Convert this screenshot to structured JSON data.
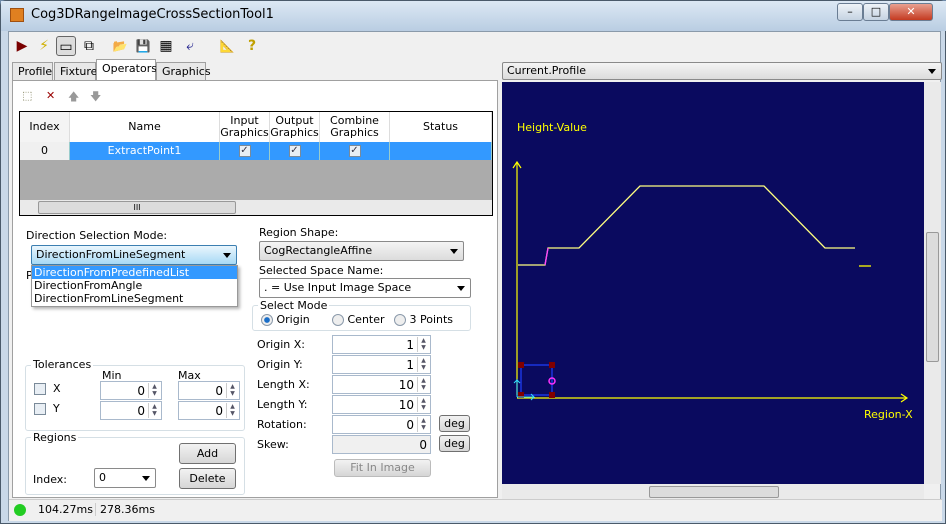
{
  "window": {
    "title": "Cog3DRangeImageCrossSectionTool1",
    "minimize": "–",
    "maximize": "□",
    "close": "✕"
  },
  "toolbar": {
    "icons": [
      "run-icon",
      "electric-icon",
      "show-controls-icon",
      "floating-icon",
      "open-icon",
      "save-icon",
      "save-settings-icon",
      "reset-icon",
      "measure-icon",
      "help-icon"
    ],
    "glyphs": [
      "▶",
      "⚡",
      "▭",
      "⧉",
      "📂",
      "💾",
      "▦",
      "⤶",
      "📐",
      "?"
    ]
  },
  "tabs": [
    {
      "label": "Profile"
    },
    {
      "label": "Fixture"
    },
    {
      "label": "Operators",
      "selected": true
    },
    {
      "label": "Graphics"
    }
  ],
  "ops_toolbar": {
    "new": "⬚",
    "delete": "✕",
    "up": "🡅",
    "down": "🡇"
  },
  "grid": {
    "columns": [
      "Index",
      "Name",
      "Input Graphics",
      "Output Graphics",
      "Combine Graphics",
      "Status"
    ],
    "rows": [
      {
        "index": "0",
        "name": "ExtractPoint1",
        "input": "✓",
        "output": "✓",
        "combine": "✓",
        "status": ""
      }
    ],
    "scroll_thumb": "III"
  },
  "direction": {
    "label": "Direction Selection Mode:",
    "value": "DirectionFromLineSegment",
    "options": [
      "DirectionFromPredefinedList",
      "DirectionFromAngle",
      "DirectionFromLineSegment"
    ],
    "highlighted": 0,
    "hidden_label_initial": "P"
  },
  "tolerances": {
    "legend": "Tolerances",
    "min": "Min",
    "max": "Max",
    "x_label": "X",
    "y_label": "Y",
    "x_min": "0",
    "x_max": "0",
    "y_min": "0",
    "y_max": "0"
  },
  "regions": {
    "legend": "Regions",
    "add": "Add",
    "delete": "Delete",
    "index_label": "Index:",
    "index_value": "0"
  },
  "region_shape": {
    "label": "Region Shape:",
    "value": "CogRectangleAffine"
  },
  "space": {
    "label": "Selected Space Name:",
    "value": ". = Use Input Image Space"
  },
  "select_mode": {
    "legend": "Select Mode",
    "options": [
      "Origin",
      "Center",
      "3 Points"
    ],
    "selected": 0
  },
  "params": [
    {
      "label": "Origin X:",
      "value": "1"
    },
    {
      "label": "Origin Y:",
      "value": "1"
    },
    {
      "label": "Length X:",
      "value": "10"
    },
    {
      "label": "Length Y:",
      "value": "10"
    },
    {
      "label": "Rotation:",
      "value": "0",
      "unit": "deg"
    },
    {
      "label": "Skew:",
      "value": "0",
      "unit": "deg"
    }
  ],
  "fit_button": "Fit In Image",
  "display": {
    "selector": "Current.Profile",
    "y_axis_label": "Height-Value",
    "x_axis_label": "Region-X",
    "background": "#0a0a5f",
    "axis_color": "#ffff00"
  },
  "status": {
    "led_color": "#22cc22",
    "time1": "104.27ms",
    "time2": "278.36ms"
  }
}
